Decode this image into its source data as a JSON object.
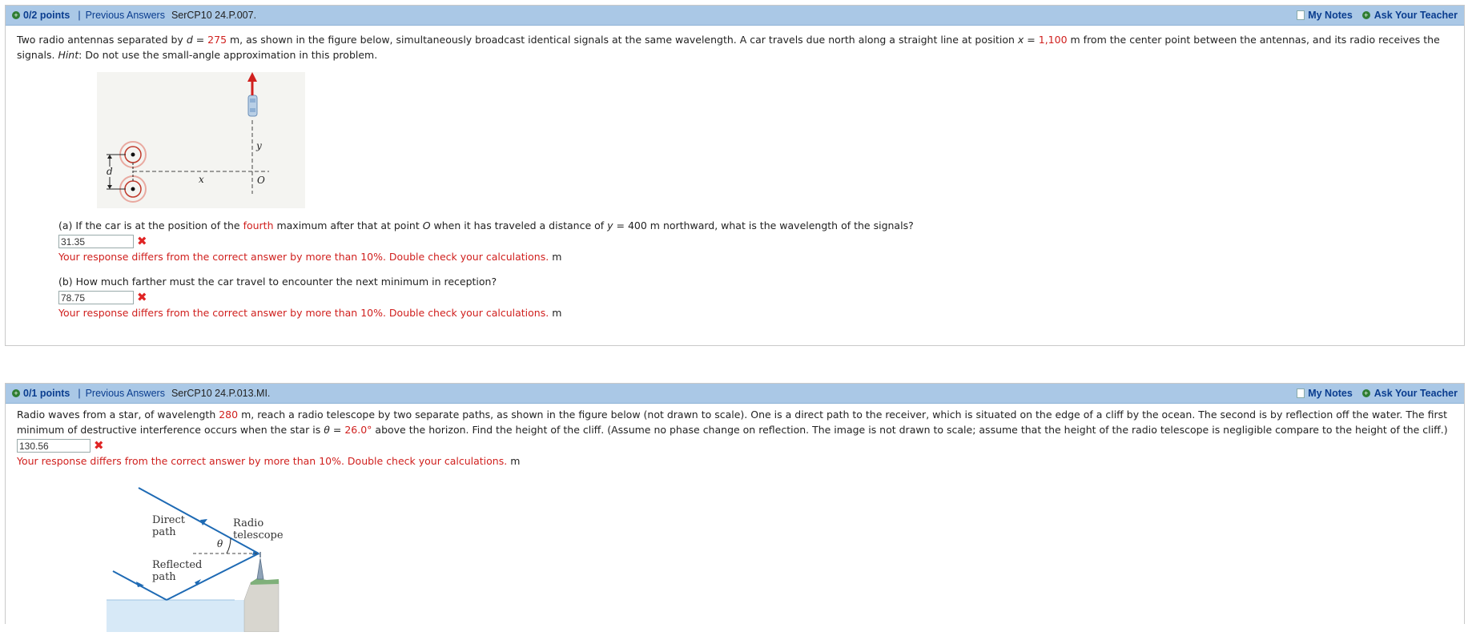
{
  "q1": {
    "points": "0/2 points",
    "separator": "|",
    "prev_answers": "Previous Answers",
    "code": "SerCP10 24.P.007.",
    "my_notes": "My Notes",
    "ask_teacher": "Ask Your Teacher",
    "text_a": "Two radio antennas separated by ",
    "d_var": "d",
    "eq": " = ",
    "d_val": "275",
    "text_b": " m, as shown in the figure below, simultaneously broadcast identical signals at the same wavelength. A car travels due north along a straight line at position ",
    "x_var": "x",
    "x_val": "1,100",
    "text_c": " m  from the center point between the antennas, and its radio receives the signals. ",
    "hint": "Hint",
    "text_d": ": Do not use the small-angle approximation in this problem.",
    "figure": {
      "label_y": "y",
      "label_d": "d",
      "label_x": "x",
      "label_o": "O"
    },
    "part_a": {
      "q_start": "(a) If the car is at the position of the ",
      "q_red": "fourth",
      "q_mid": " maximum after that at point ",
      "o_var": "O",
      "q_mid2": " when it has traveled a distance of ",
      "y_var": "y",
      "q_end": " = 400 m  northward, what is the wavelength of the signals?",
      "answer": "31.35",
      "feedback": "Your response differs from the correct answer by more than 10%. Double check your calculations.",
      "unit": "m"
    },
    "part_b": {
      "question": "(b) How much farther must the car travel to encounter the next minimum in reception?",
      "answer": "78.75",
      "feedback": "Your response differs from the correct answer by more than 10%. Double check your calculations.",
      "unit": "m"
    }
  },
  "q2": {
    "points": "0/1 points",
    "separator": "|",
    "prev_answers": "Previous Answers",
    "code": "SerCP10 24.P.013.MI.",
    "my_notes": "My Notes",
    "ask_teacher": "Ask Your Teacher",
    "text_a": "Radio waves from a star, of wavelength ",
    "lambda_val": "280",
    "text_b": " m, reach a radio telescope by two separate paths, as shown in the figure below (not drawn to scale). One is a direct path to the receiver, which is situated on the edge of a cliff by the ocean. The second is by reflection off the water. The first minimum of destructive interference occurs when the star is ",
    "theta_var": "θ",
    "eq": " = ",
    "theta_val": "26.0°",
    "text_c": " above the horizon. Find the height of the cliff. (Assume no phase change on reflection. The image is not drawn to scale; assume that the height of the radio telescope is negligible compare to the height of the cliff.)",
    "answer": "130.56",
    "feedback": "Your response differs from the correct answer by more than 10%. Double check your calculations.",
    "unit": "m",
    "figure": {
      "direct_1": "Direct",
      "direct_2": "path",
      "radio_1": "Radio",
      "radio_2": "telescope",
      "theta": "θ",
      "reflected_1": "Reflected",
      "reflected_2": "path"
    }
  }
}
